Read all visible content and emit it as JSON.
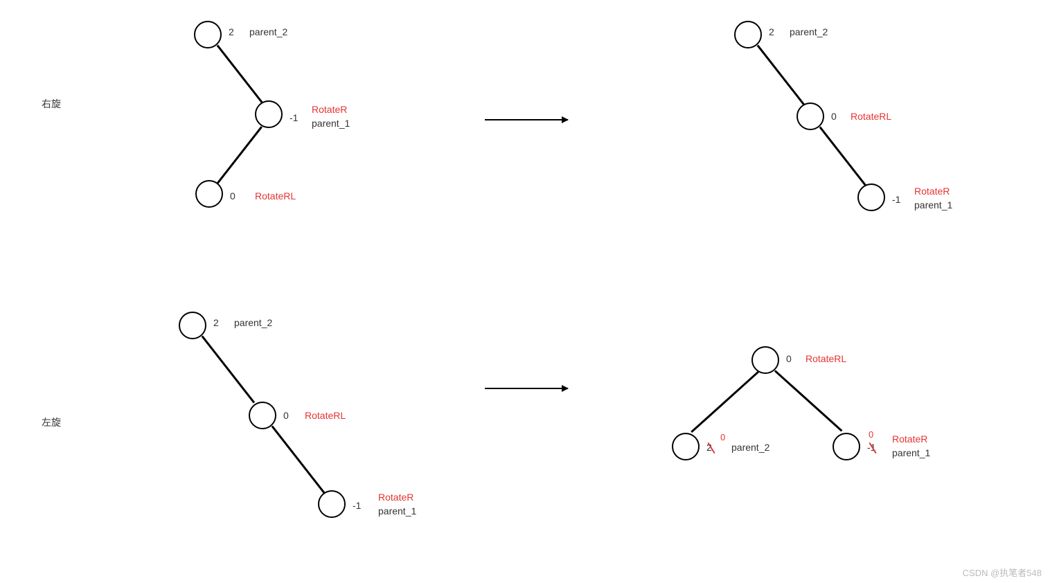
{
  "watermark": "CSDN @执笔者548",
  "row1": {
    "rotation_label": "右旋",
    "left": {
      "n1": {
        "bf": "2",
        "lbl": "parent_2"
      },
      "n2": {
        "bf": "-1",
        "red": "RotateR",
        "lbl": "parent_1"
      },
      "n3": {
        "bf": "0",
        "red": "RotateRL"
      }
    },
    "right": {
      "n1": {
        "bf": "2",
        "lbl": "parent_2"
      },
      "n2": {
        "bf": "0",
        "red": "RotateRL"
      },
      "n3": {
        "bf": "-1",
        "red": "RotateR",
        "lbl": "parent_1"
      }
    }
  },
  "row2": {
    "rotation_label": "左旋",
    "left": {
      "n1": {
        "bf": "2",
        "lbl": "parent_2"
      },
      "n2": {
        "bf": "0",
        "red": "RotateRL"
      },
      "n3": {
        "bf": "-1",
        "red": "RotateR",
        "lbl": "parent_1"
      }
    },
    "right": {
      "root": {
        "bf": "0",
        "red": "RotateRL"
      },
      "left_child": {
        "old_bf": "2",
        "new_bf": "0",
        "lbl": "parent_2"
      },
      "right_child": {
        "old_bf": "-1",
        "new_bf": "0",
        "red": "RotateR",
        "lbl": "parent_1"
      }
    }
  }
}
